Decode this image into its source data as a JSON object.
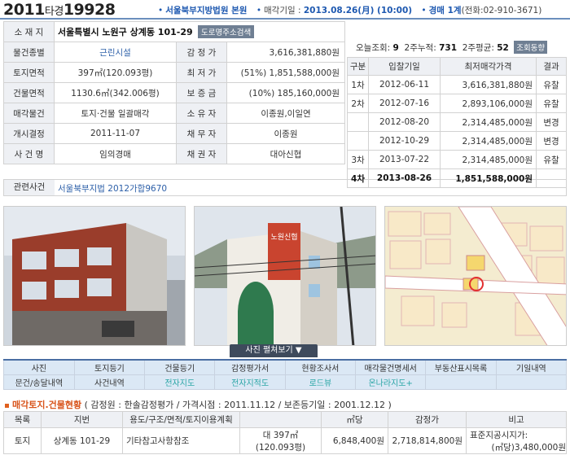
{
  "header": {
    "case_year": "2011",
    "case_type": "타경",
    "case_num": "19928",
    "court": "서울북부지방법원 본원",
    "sale_label": "매각기일 :",
    "sale_date": "2013.08.26(月) (10:00)",
    "dept": "경매 1계",
    "phone": "(전화:02-910-3671)"
  },
  "info": {
    "address_label": "소 재 지",
    "address": "서울특별시 노원구 상계동 101-29",
    "road_btn": "도로명주소검색",
    "rows": [
      {
        "l1": "물건종별",
        "v1": "근린시설",
        "l2": "감 정 가",
        "v2": "3,616,381,880원"
      },
      {
        "l1": "토지면적",
        "v1": "397㎡(120.093평)",
        "l2": "최 저 가",
        "v2": "(51%) 1,851,588,000원"
      },
      {
        "l1": "건물면적",
        "v1": "1130.6㎡(342.006평)",
        "l2": "보 증 금",
        "v2": "(10%) 185,160,000원"
      },
      {
        "l1": "매각물건",
        "v1": "토지·건물 일괄매각",
        "l2": "소 유 자",
        "v2": "이종원,이일연"
      },
      {
        "l1": "개시결정",
        "v1": "2011-11-07",
        "l2": "채 무 자",
        "v2": "이종원"
      },
      {
        "l1": "사 건 명",
        "v1": "임의경매",
        "l2": "채 권 자",
        "v2": "대아신협"
      }
    ],
    "related_label": "관련사건",
    "related_value": "서울북부지법 2012가합9670"
  },
  "views": {
    "today_label": "오늘조회:",
    "today": "9",
    "two_week_label": "2주누적:",
    "two_week": "731",
    "two_week_avg_label": "2주평균:",
    "two_week_avg": "52",
    "btn": "조회동향"
  },
  "history": {
    "headers": [
      "구분",
      "입찰기일",
      "최저매각가격",
      "결과"
    ],
    "rows": [
      {
        "round": "1차",
        "date": "2012-06-11",
        "price": "3,616,381,880원",
        "result": "유찰"
      },
      {
        "round": "2차",
        "date": "2012-07-16",
        "price": "2,893,106,000원",
        "result": "유찰"
      },
      {
        "round": "",
        "date": "2012-08-20",
        "price": "2,314,485,000원",
        "result": "변경"
      },
      {
        "round": "",
        "date": "2012-10-29",
        "price": "2,314,485,000원",
        "result": "변경"
      },
      {
        "round": "3차",
        "date": "2013-07-22",
        "price": "2,314,485,000원",
        "result": "유찰"
      },
      {
        "round": "4차",
        "date": "2013-08-26",
        "price": "1,851,588,000원",
        "result": ""
      }
    ]
  },
  "photos": {
    "expand_btn": "사진 펼쳐보기 ▼",
    "sign_text": "노원신협"
  },
  "menu": {
    "row1": [
      "사진",
      "토지등기",
      "건물등기",
      "감정평가서",
      "현황조사서",
      "매각물건명세서",
      "부동산표시목록",
      "기일내역"
    ],
    "row2": [
      "문건/송달내역",
      "사건내역",
      "전자지도",
      "전자지적도",
      "로드뷰",
      "온나라지도+",
      "",
      ""
    ]
  },
  "section": {
    "title": "매각토지.건물현황",
    "detail": "( 감정원 : 한솔감정평가 / 가격시점 : 2011.11.12 / 보존등기일 : 2001.12.12 )"
  },
  "land": {
    "headers": [
      "목록",
      "지번",
      "용도/구조/면적/토지이용계획",
      "",
      "㎡당",
      "감정가",
      "비고"
    ],
    "row": {
      "type": "토지",
      "lot": "상계동 101-29",
      "use": "기타참고사항참조",
      "area": "대 397㎡",
      "area_py": "(120.093평)",
      "per_m2": "6,848,400원",
      "appraisal": "2,718,814,800원",
      "note1": "표준지공시지가:",
      "note2": "(㎡당)3,480,000원"
    }
  },
  "colors": {
    "header_blue": "#1d58b0",
    "menu_bg": "#dbe8f5",
    "section_orange": "#d8541b"
  }
}
